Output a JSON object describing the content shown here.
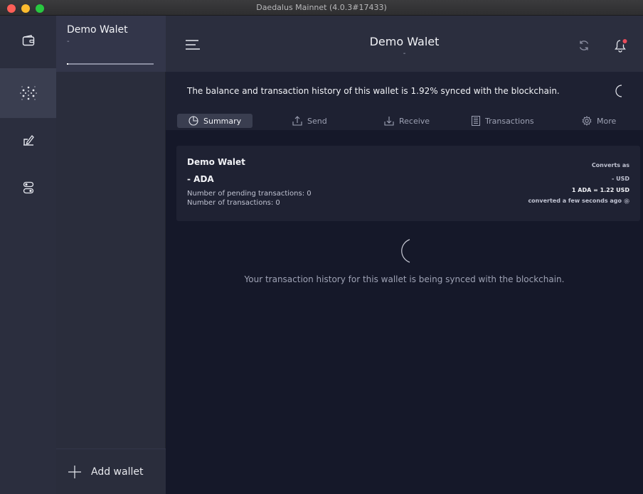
{
  "window": {
    "title": "Daedalus Mainnet (4.0.3#17433)"
  },
  "nav": {
    "items": [
      {
        "name": "wallets",
        "icon": "wallet-icon",
        "active": false
      },
      {
        "name": "staking",
        "icon": "staking-icon",
        "active": true
      },
      {
        "name": "voting",
        "icon": "voting-icon",
        "active": false
      },
      {
        "name": "settings",
        "icon": "settings-toggle-icon",
        "active": false
      }
    ]
  },
  "wallet_list": {
    "wallets": [
      {
        "name": "Demo Walet",
        "amount": "-",
        "sync_progress": 0.02
      }
    ],
    "add_wallet_label": "Add wallet"
  },
  "topbar": {
    "title": "Demo Walet",
    "subtitle": "-",
    "menu_icon": "hamburger-icon",
    "sync_icon": "refresh-icon",
    "notification_icon": "bell-icon"
  },
  "sync_banner": {
    "text": "The balance and transaction history of this wallet is 1.92% synced with the blockchain."
  },
  "tabs": [
    {
      "label": "Summary",
      "icon": "summary-icon",
      "active": true
    },
    {
      "label": "Send",
      "icon": "send-icon",
      "active": false
    },
    {
      "label": "Receive",
      "icon": "receive-icon",
      "active": false
    },
    {
      "label": "Transactions",
      "icon": "transactions-icon",
      "active": false
    },
    {
      "label": "More",
      "icon": "gear-icon",
      "active": false
    }
  ],
  "summary": {
    "wallet_name": "Demo Walet",
    "amount": "- ADA",
    "pending": "Number of pending transactions: 0",
    "count": "Number of transactions: 0",
    "converts_as": "Converts as",
    "converted_value": "- USD",
    "rate": "1 ADA = 1.22 USD",
    "converted_time": "converted a few seconds ago"
  },
  "history": {
    "text": "Your transaction history for this wallet is being synced with the blockchain."
  },
  "colors": {
    "background": "#151829",
    "sidebar": "#2b2e3e",
    "notification_dot": "#ea4c5b"
  }
}
